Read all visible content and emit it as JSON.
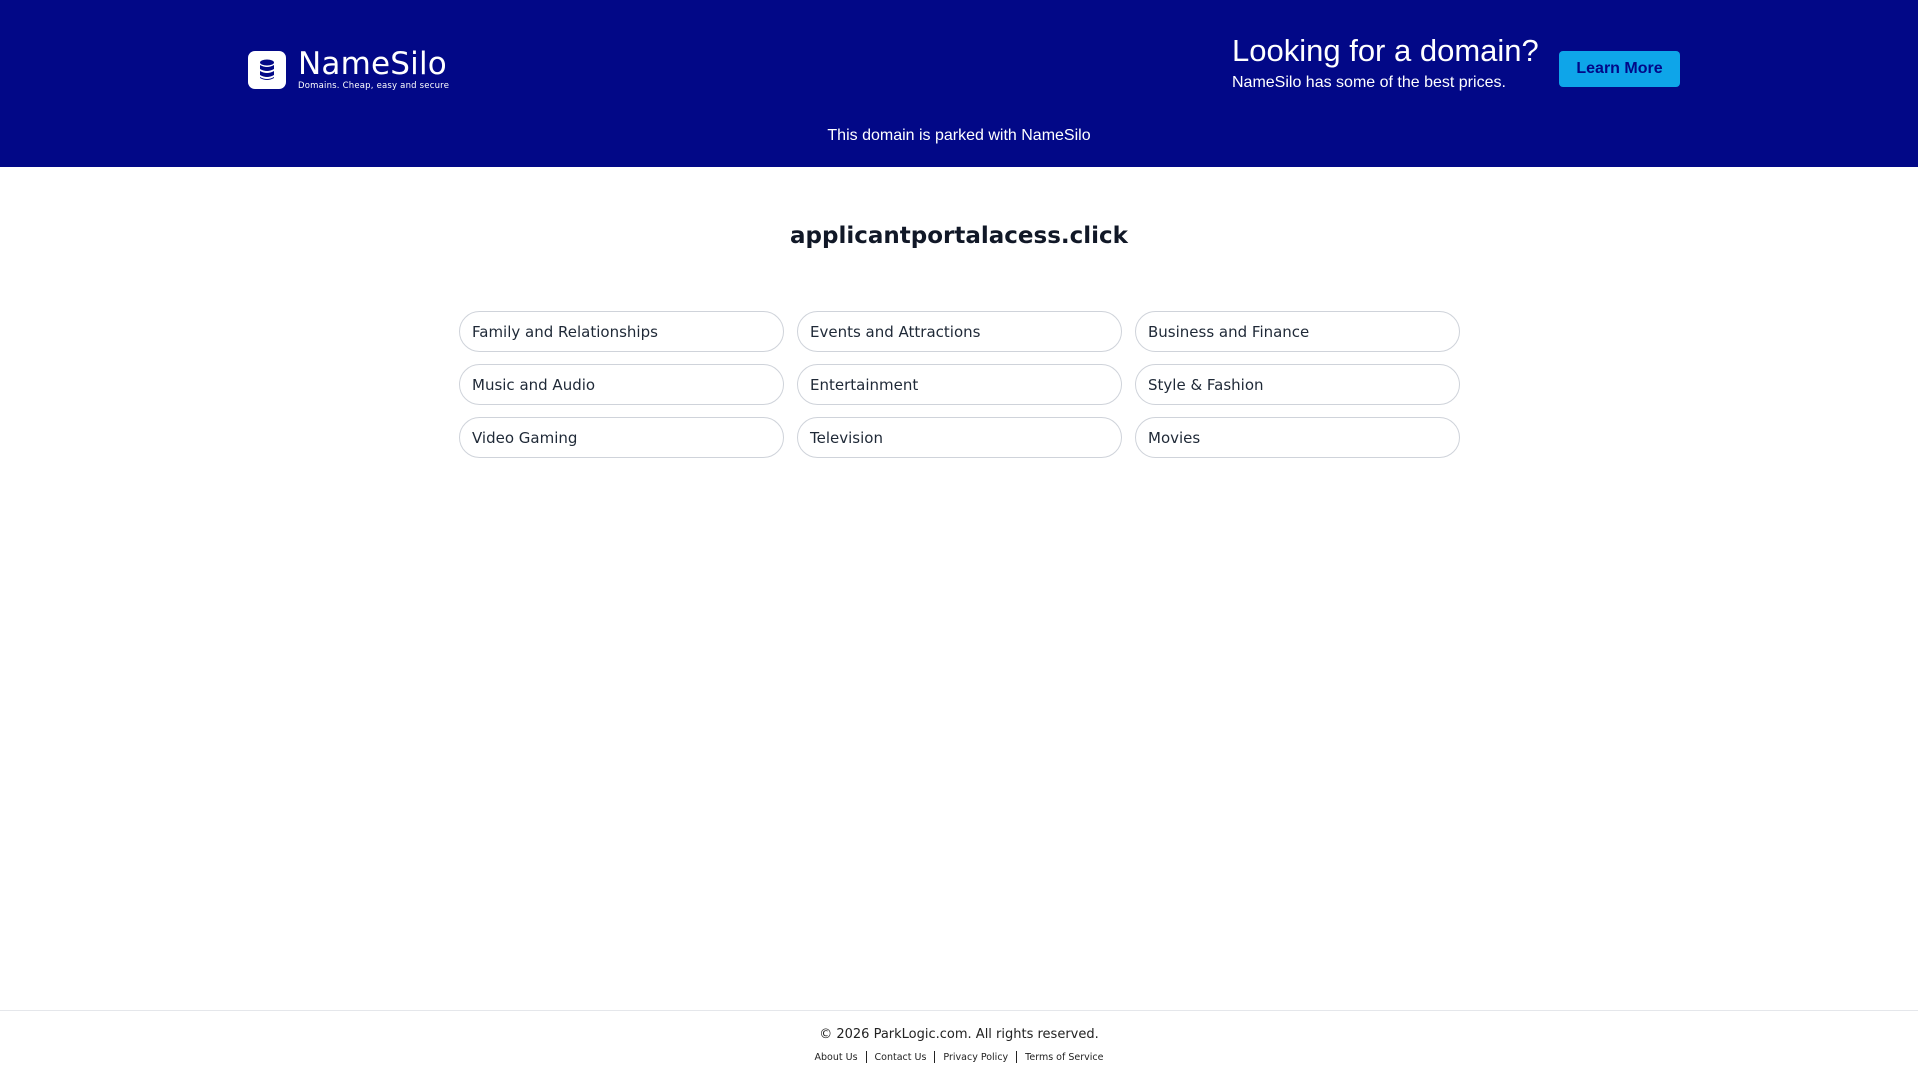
{
  "header": {
    "logo_name": "NameSilo",
    "logo_tagline": "Domains. Cheap, easy and secure",
    "logo_icon": "database-icon",
    "promo_title": "Looking for a domain?",
    "promo_subtitle": "NameSilo has some of the best prices.",
    "learn_more_label": "Learn More",
    "parked_message": "This domain is parked with NameSilo",
    "colors": {
      "background": "#020887",
      "button": "#0ea5e9"
    }
  },
  "main": {
    "domain": "applicantportalacess.click",
    "categories": [
      {
        "label": "Family and Relationships"
      },
      {
        "label": "Events and Attractions"
      },
      {
        "label": "Business and Finance"
      },
      {
        "label": "Music and Audio"
      },
      {
        "label": "Entertainment"
      },
      {
        "label": "Style & Fashion"
      },
      {
        "label": "Video Gaming"
      },
      {
        "label": "Television"
      },
      {
        "label": "Movies"
      }
    ]
  },
  "footer": {
    "copyright": "© 2026 ParkLogic.com. All rights reserved.",
    "links": [
      {
        "label": "About Us"
      },
      {
        "label": "Contact Us"
      },
      {
        "label": "Privacy Policy"
      },
      {
        "label": "Terms of Service"
      }
    ]
  }
}
